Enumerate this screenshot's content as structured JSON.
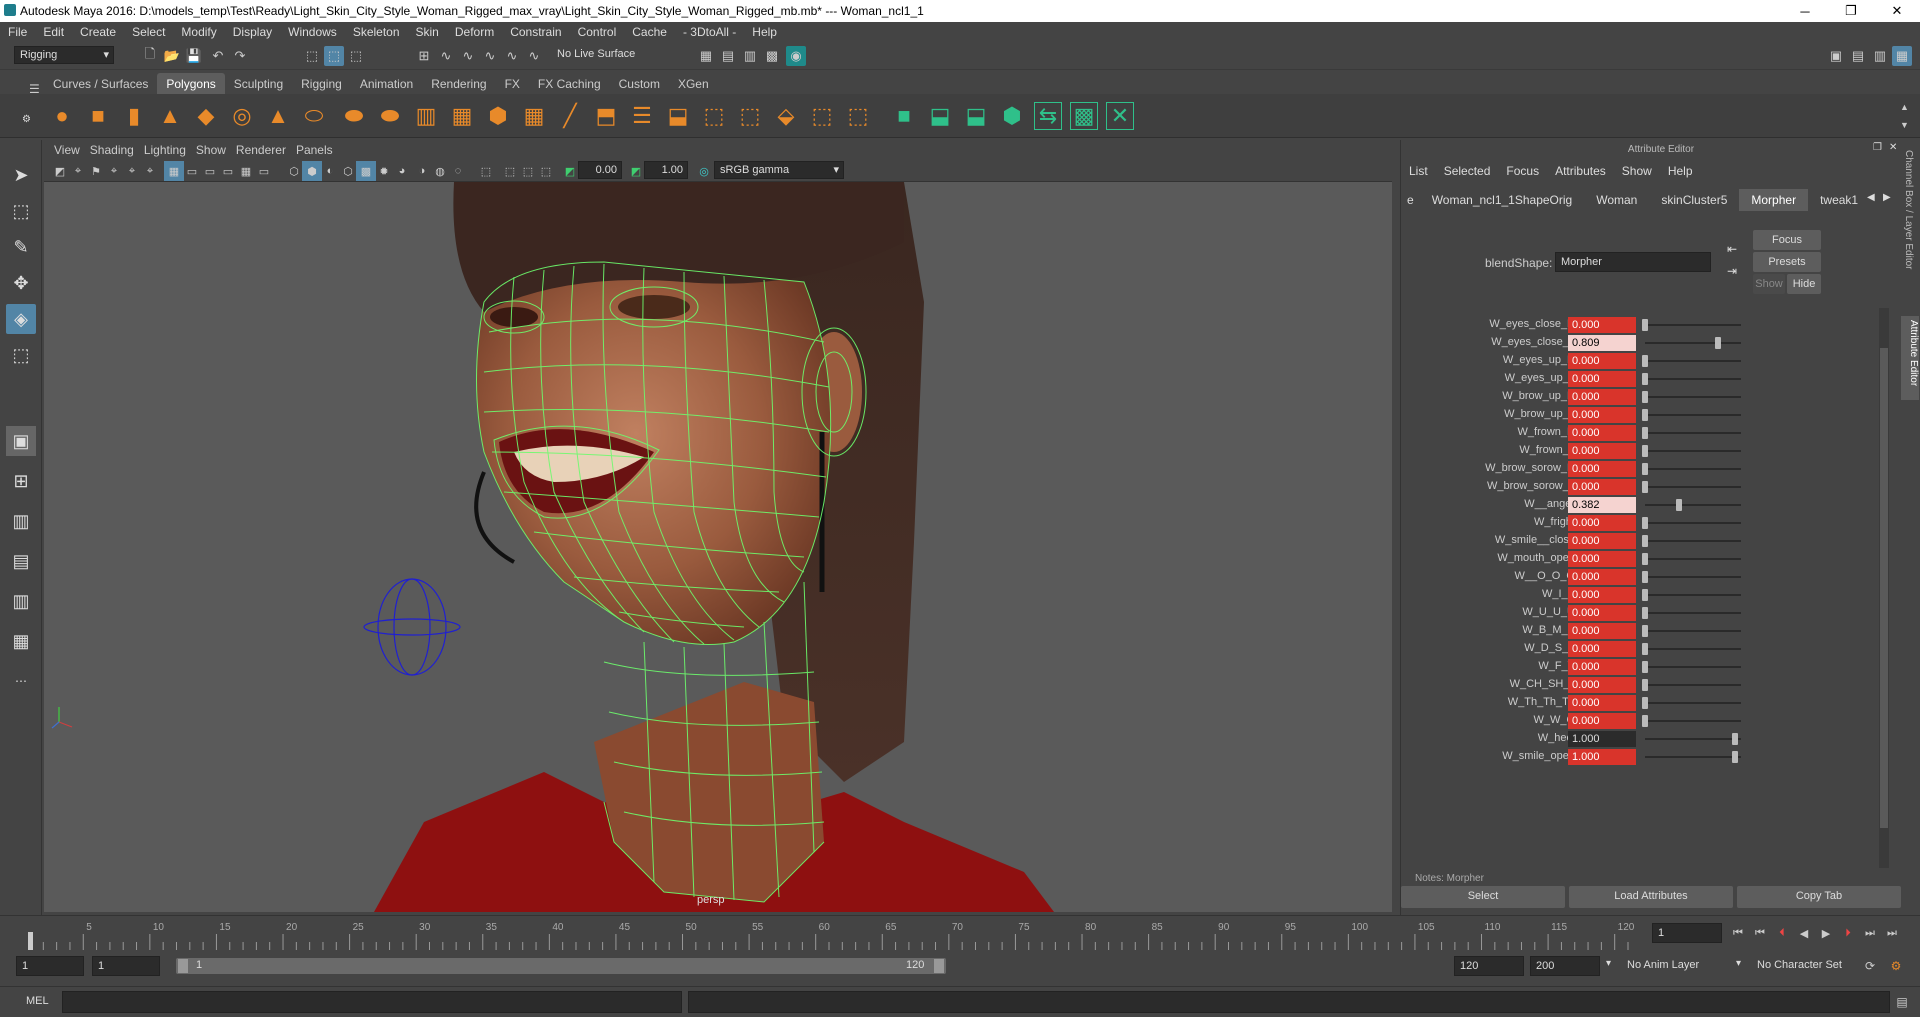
{
  "window": {
    "title": "Autodesk Maya 2016: D:\\models_temp\\Test\\Ready\\Light_Skin_City_Style_Woman_Rigged_max_vray\\Light_Skin_City_Style_Woman_Rigged_mb.mb*   ---   Woman_ncl1_1"
  },
  "menubar": [
    "File",
    "Edit",
    "Create",
    "Select",
    "Modify",
    "Display",
    "Windows",
    "Skeleton",
    "Skin",
    "Deform",
    "Constrain",
    "Control",
    "Cache",
    "- 3DtoAll -",
    "Help"
  ],
  "statusline": {
    "mode": "Rigging",
    "live_surface": "No Live Surface"
  },
  "shelf": {
    "tabs": [
      "Curves / Surfaces",
      "Polygons",
      "Sculpting",
      "Rigging",
      "Animation",
      "Rendering",
      "FX",
      "FX Caching",
      "Custom",
      "XGen"
    ],
    "active_tab": "Polygons"
  },
  "viewport": {
    "menu": [
      "View",
      "Shading",
      "Lighting",
      "Show",
      "Renderer",
      "Panels"
    ],
    "near_value": "0.00",
    "far_value": "1.00",
    "color_space": "sRGB gamma",
    "camera_label": "persp"
  },
  "attribute_editor": {
    "title": "Attribute Editor",
    "menu": [
      "List",
      "Selected",
      "Focus",
      "Attributes",
      "Show",
      "Help"
    ],
    "tabs": [
      "e",
      "Woman_ncl1_1ShapeOrig",
      "Woman",
      "skinCluster5",
      "Morpher",
      "tweak1"
    ],
    "active_tab": "Morpher",
    "blendshape_label": "blendShape:",
    "blendshape_value": "Morpher",
    "focus_btn": "Focus",
    "presets_btn": "Presets",
    "show_btn": "Show",
    "hide_btn": "Hide",
    "attributes": [
      {
        "name": "W_eyes_close_R",
        "value": "0.000",
        "state": "keyed",
        "slider": 0.0
      },
      {
        "name": "W_eyes_close_L",
        "value": "0.809",
        "state": "selected",
        "slider": 0.809
      },
      {
        "name": "W_eyes_up_R",
        "value": "0.000",
        "state": "keyed",
        "slider": 0.0
      },
      {
        "name": "W_eyes_up_L",
        "value": "0.000",
        "state": "keyed",
        "slider": 0.0
      },
      {
        "name": "W_brow_up_R",
        "value": "0.000",
        "state": "keyed",
        "slider": 0.0
      },
      {
        "name": "W_brow_up_L",
        "value": "0.000",
        "state": "keyed",
        "slider": 0.0
      },
      {
        "name": "W_frown_R",
        "value": "0.000",
        "state": "keyed",
        "slider": 0.0
      },
      {
        "name": "W_frown_L",
        "value": "0.000",
        "state": "keyed",
        "slider": 0.0
      },
      {
        "name": "W_brow_sorow_R",
        "value": "0.000",
        "state": "keyed",
        "slider": 0.0
      },
      {
        "name": "W_brow_sorow_L",
        "value": "0.000",
        "state": "keyed",
        "slider": 0.0
      },
      {
        "name": "W__anger",
        "value": "0.382",
        "state": "selected",
        "slider": 0.382
      },
      {
        "name": "W_fright",
        "value": "0.000",
        "state": "keyed",
        "slider": 0.0
      },
      {
        "name": "W_smile__close",
        "value": "0.000",
        "state": "keyed",
        "slider": 0.0
      },
      {
        "name": "W_mouth_open",
        "value": "0.000",
        "state": "keyed",
        "slider": 0.0
      },
      {
        "name": "W__O_O_O",
        "value": "0.000",
        "state": "keyed",
        "slider": 0.0
      },
      {
        "name": "W_I_E",
        "value": "0.000",
        "state": "keyed",
        "slider": 0.0
      },
      {
        "name": "W_U_U_U",
        "value": "0.000",
        "state": "keyed",
        "slider": 0.0
      },
      {
        "name": "W_B_M_P",
        "value": "0.000",
        "state": "keyed",
        "slider": 0.0
      },
      {
        "name": "W_D_S_T",
        "value": "0.000",
        "state": "keyed",
        "slider": 0.0
      },
      {
        "name": "W_F_V",
        "value": "0.000",
        "state": "keyed",
        "slider": 0.0
      },
      {
        "name": "W_CH_SH_J",
        "value": "0.000",
        "state": "keyed",
        "slider": 0.0
      },
      {
        "name": "W_Th_Th_Th",
        "value": "0.000",
        "state": "keyed",
        "slider": 0.0
      },
      {
        "name": "W_W_Q",
        "value": "0.000",
        "state": "keyed",
        "slider": 0.0
      },
      {
        "name": "W_heel",
        "value": "1.000",
        "state": "normal",
        "slider": 1.0
      },
      {
        "name": "W_smile_open",
        "value": "1.000",
        "state": "keyed",
        "slider": 1.0
      }
    ],
    "notes_label": "Notes: Morpher",
    "bottom_buttons": [
      "Select",
      "Load Attributes",
      "Copy Tab"
    ],
    "side_tabs": [
      "Channel Box / Layer Editor",
      "Attribute Editor"
    ]
  },
  "timeline": {
    "ticks": [
      "5",
      "10",
      "15",
      "20",
      "25",
      "30",
      "35",
      "40",
      "45",
      "50",
      "55",
      "60",
      "65",
      "70",
      "75",
      "80",
      "85",
      "90",
      "95",
      "100",
      "105",
      "110",
      "115",
      "120"
    ],
    "current_frame": "1",
    "range_start": "1",
    "playback_start": "1",
    "range_bar_start": "1",
    "range_bar_end": "120",
    "playback_end": "120",
    "range_end": "200",
    "anim_layer": "No Anim Layer",
    "character_set": "No Character Set"
  },
  "cmdline": {
    "label": "MEL"
  },
  "colors": {
    "keyed": "#d9342b",
    "selected": "#f5d3d0",
    "wireframe": "#6dfb6d",
    "accent": "#5285a6"
  }
}
